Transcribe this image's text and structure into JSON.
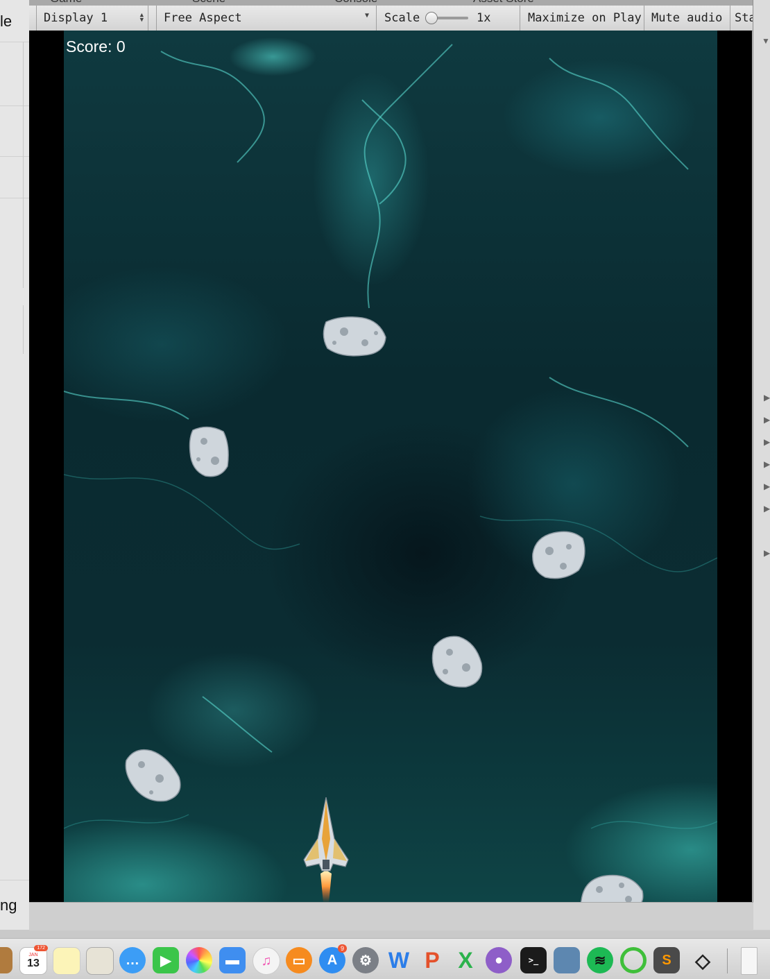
{
  "left_panel": {
    "top_fragment": "le",
    "bottom_fragment": "ng"
  },
  "tabs": [
    "Game",
    "Scene",
    "Console",
    "Asset Store"
  ],
  "toolbar": {
    "display": "Display 1",
    "aspect": "Free Aspect",
    "scale_label": "Scale",
    "scale_value": "1x",
    "maximize": "Maximize on Play",
    "mute": "Mute audio",
    "stats": "Stats"
  },
  "game": {
    "score": "Score: 0"
  },
  "dock": {
    "calendar_month": "JAN",
    "calendar_day": "13",
    "calendar_badge": "172",
    "appstore_badge": "9",
    "items": [
      "finder-icon",
      "calendar-icon",
      "notes-icon",
      "preview-icon",
      "messages-icon",
      "facetime-icon",
      "photos-icon",
      "keynote-icon",
      "itunes-icon",
      "ibooks-icon",
      "app-store-icon",
      "system-preferences-icon",
      "word-icon",
      "powerpoint-icon",
      "excel-icon",
      "github-icon",
      "terminal-icon",
      "image-viewer-icon",
      "spotify-icon",
      "activity-ring-icon",
      "sublime-text-icon",
      "unity-icon",
      "document-icon"
    ]
  }
}
